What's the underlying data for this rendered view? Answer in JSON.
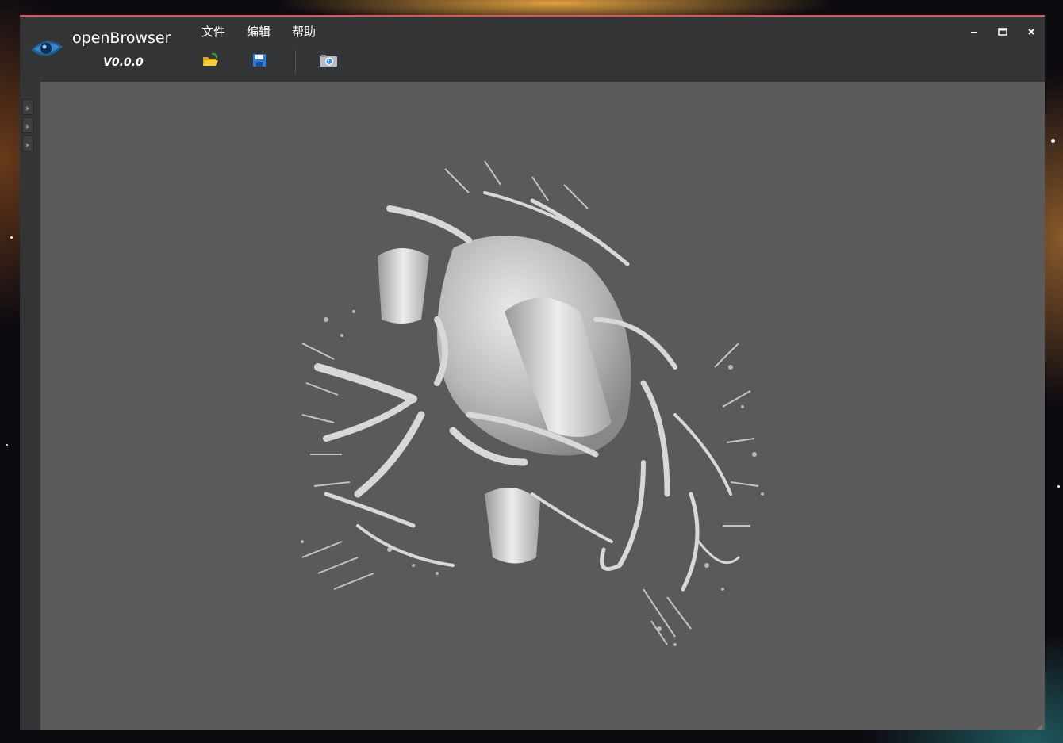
{
  "window": {
    "app_name": "openBrowser",
    "version": "V0.0.0"
  },
  "menu": {
    "items": [
      "文件",
      "编辑",
      "帮助"
    ]
  },
  "toolbar": {
    "buttons": [
      "open-folder-icon",
      "save-icon",
      "camera-icon"
    ]
  },
  "window_controls": [
    "minimize-icon",
    "maximize-icon",
    "close-icon"
  ],
  "left_rail": {
    "buttons": [
      "expand-arrow-icon",
      "expand-arrow-icon",
      "expand-arrow-icon"
    ]
  },
  "viewport": {
    "background": "#5a5a5a",
    "content": "3D volume rendering"
  },
  "colors": {
    "accent_border": "#e05555",
    "chrome": "#333436"
  }
}
